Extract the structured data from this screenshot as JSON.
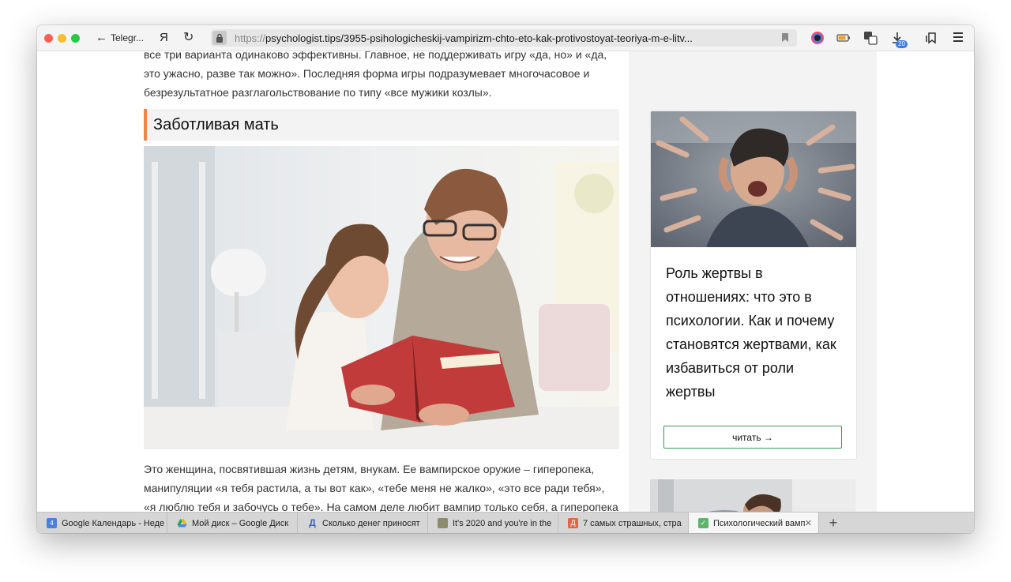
{
  "browser": {
    "back_label": "Telegr...",
    "ya_label": "Я",
    "url_protocol": "https://",
    "url_rest": "psychologist.tips/3955-psihologicheskij-vampirizm-chto-eto-kak-protivostoyat-teoriya-m-e-litv...",
    "downloads_badge": "20"
  },
  "article": {
    "para_top": "все три варианта одинаково эффективны. Главное, не поддерживать игру «да, но» и «да, это ужасно, разве так можно». Последняя форма игры подразумевает многочасовое и безрезультатное разглагольствование по типу «все мужики козлы».",
    "heading": "Заботливая мать",
    "para_bottom": "Это женщина, посвятившая жизнь детям, внукам. Ее вампирское оружие – гиперопека, манипуляции «я тебя растила, а ты вот как», «тебе меня не жалко», «это все ради тебя», «я люблю тебя и забочусь о тебе». На самом деле любит вампир только себя, а гиперопека –"
  },
  "sidebar": {
    "card_title": "Роль жертвы в отношениях: что это в психологии. Как и почему становятся жертвами, как избавиться от роли жертвы",
    "read_button": "читать →"
  },
  "tabs": [
    {
      "title": "Google Календарь - Неде",
      "favicon": "#4a7fe0",
      "fav_text": "4"
    },
    {
      "title": "Мой диск – Google Диск",
      "favicon": "#f5b400",
      "fav_text": ""
    },
    {
      "title": "Сколько денег приносят",
      "favicon": "#3a5fc9",
      "fav_text": "Д"
    },
    {
      "title": "It's 2020 and you're in the",
      "favicon": "#8c8c6a",
      "fav_text": ""
    },
    {
      "title": "7 самых страшных, стра",
      "favicon": "#e0654a",
      "fav_text": "Д"
    },
    {
      "title": "Психологический вамп",
      "favicon": "#5bb56a",
      "fav_text": "✓"
    }
  ]
}
